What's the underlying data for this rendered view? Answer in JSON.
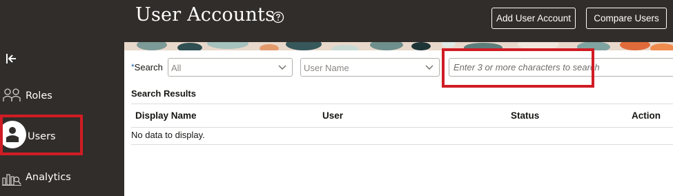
{
  "page": {
    "title": "User Accounts"
  },
  "header": {
    "add_user_account_label": "Add User Account",
    "compare_users_label": "Compare Users"
  },
  "sidebar": {
    "collapse_icon": "collapse-left-icon",
    "items": [
      {
        "label": "Roles",
        "icon": "roles-icon"
      },
      {
        "label": "Users",
        "icon": "user-icon",
        "selected": true
      },
      {
        "label": "Analytics",
        "icon": "analytics-icon"
      }
    ]
  },
  "search": {
    "label": "Search",
    "required_marker": "*",
    "scope_value": "All",
    "field_value": "User Name",
    "placeholder": "Enter 3 or more characters to search"
  },
  "results": {
    "title": "Search Results",
    "columns": [
      "Display Name",
      "User",
      "Status",
      "Action"
    ],
    "empty_message": "No data to display."
  },
  "colors": {
    "header_bg": "#312d2a",
    "highlight": "#d01c24",
    "text": "#161513"
  }
}
